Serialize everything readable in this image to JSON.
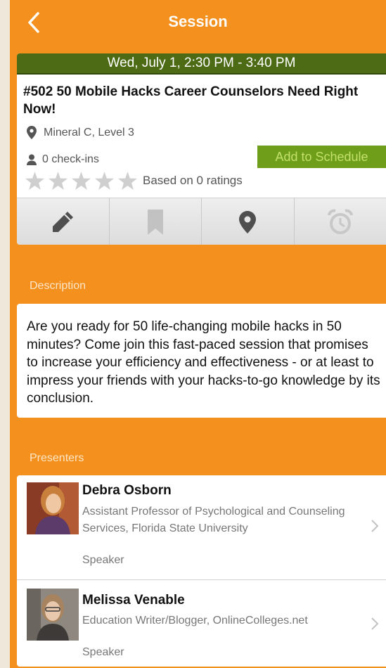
{
  "nav": {
    "title": "Session",
    "back_icon": "chevron-left-icon"
  },
  "session": {
    "datetime": "Wed, July 1, 2:30 PM - 3:40 PM",
    "title": "#502 50 Mobile Hacks Career Counselors Need Right Now!",
    "location": "Mineral C, Level 3",
    "checkins": "0 check-ins",
    "add_button": "Add to Schedule",
    "rating_text": "Based on 0 ratings",
    "stars_filled": 0,
    "stars_total": 5
  },
  "actions": [
    {
      "icon": "pencil-icon"
    },
    {
      "icon": "bookmark-icon"
    },
    {
      "icon": "map-pin-icon"
    },
    {
      "icon": "alarm-clock-icon"
    }
  ],
  "description": {
    "label": "Description",
    "text": "Are you ready for 50 life-changing mobile hacks in 50 minutes? Come join this fast-paced session that promises to increase your efficiency and effectiveness - or at least to impress your friends with your hacks-to-go knowledge by its conclusion."
  },
  "presenters": {
    "label": "Presenters",
    "items": [
      {
        "name": "Debra Osborn",
        "title": "Assistant Professor of Psychological and Counseling Services, Florida State University",
        "role": "Speaker"
      },
      {
        "name": "Melissa Venable",
        "title": "Education Writer/Blogger, OnlineColleges.net",
        "role": "Speaker"
      }
    ]
  },
  "colors": {
    "accent": "#f4901d",
    "date_bar": "#4c6b14",
    "add_button": "#6e9e1a"
  }
}
